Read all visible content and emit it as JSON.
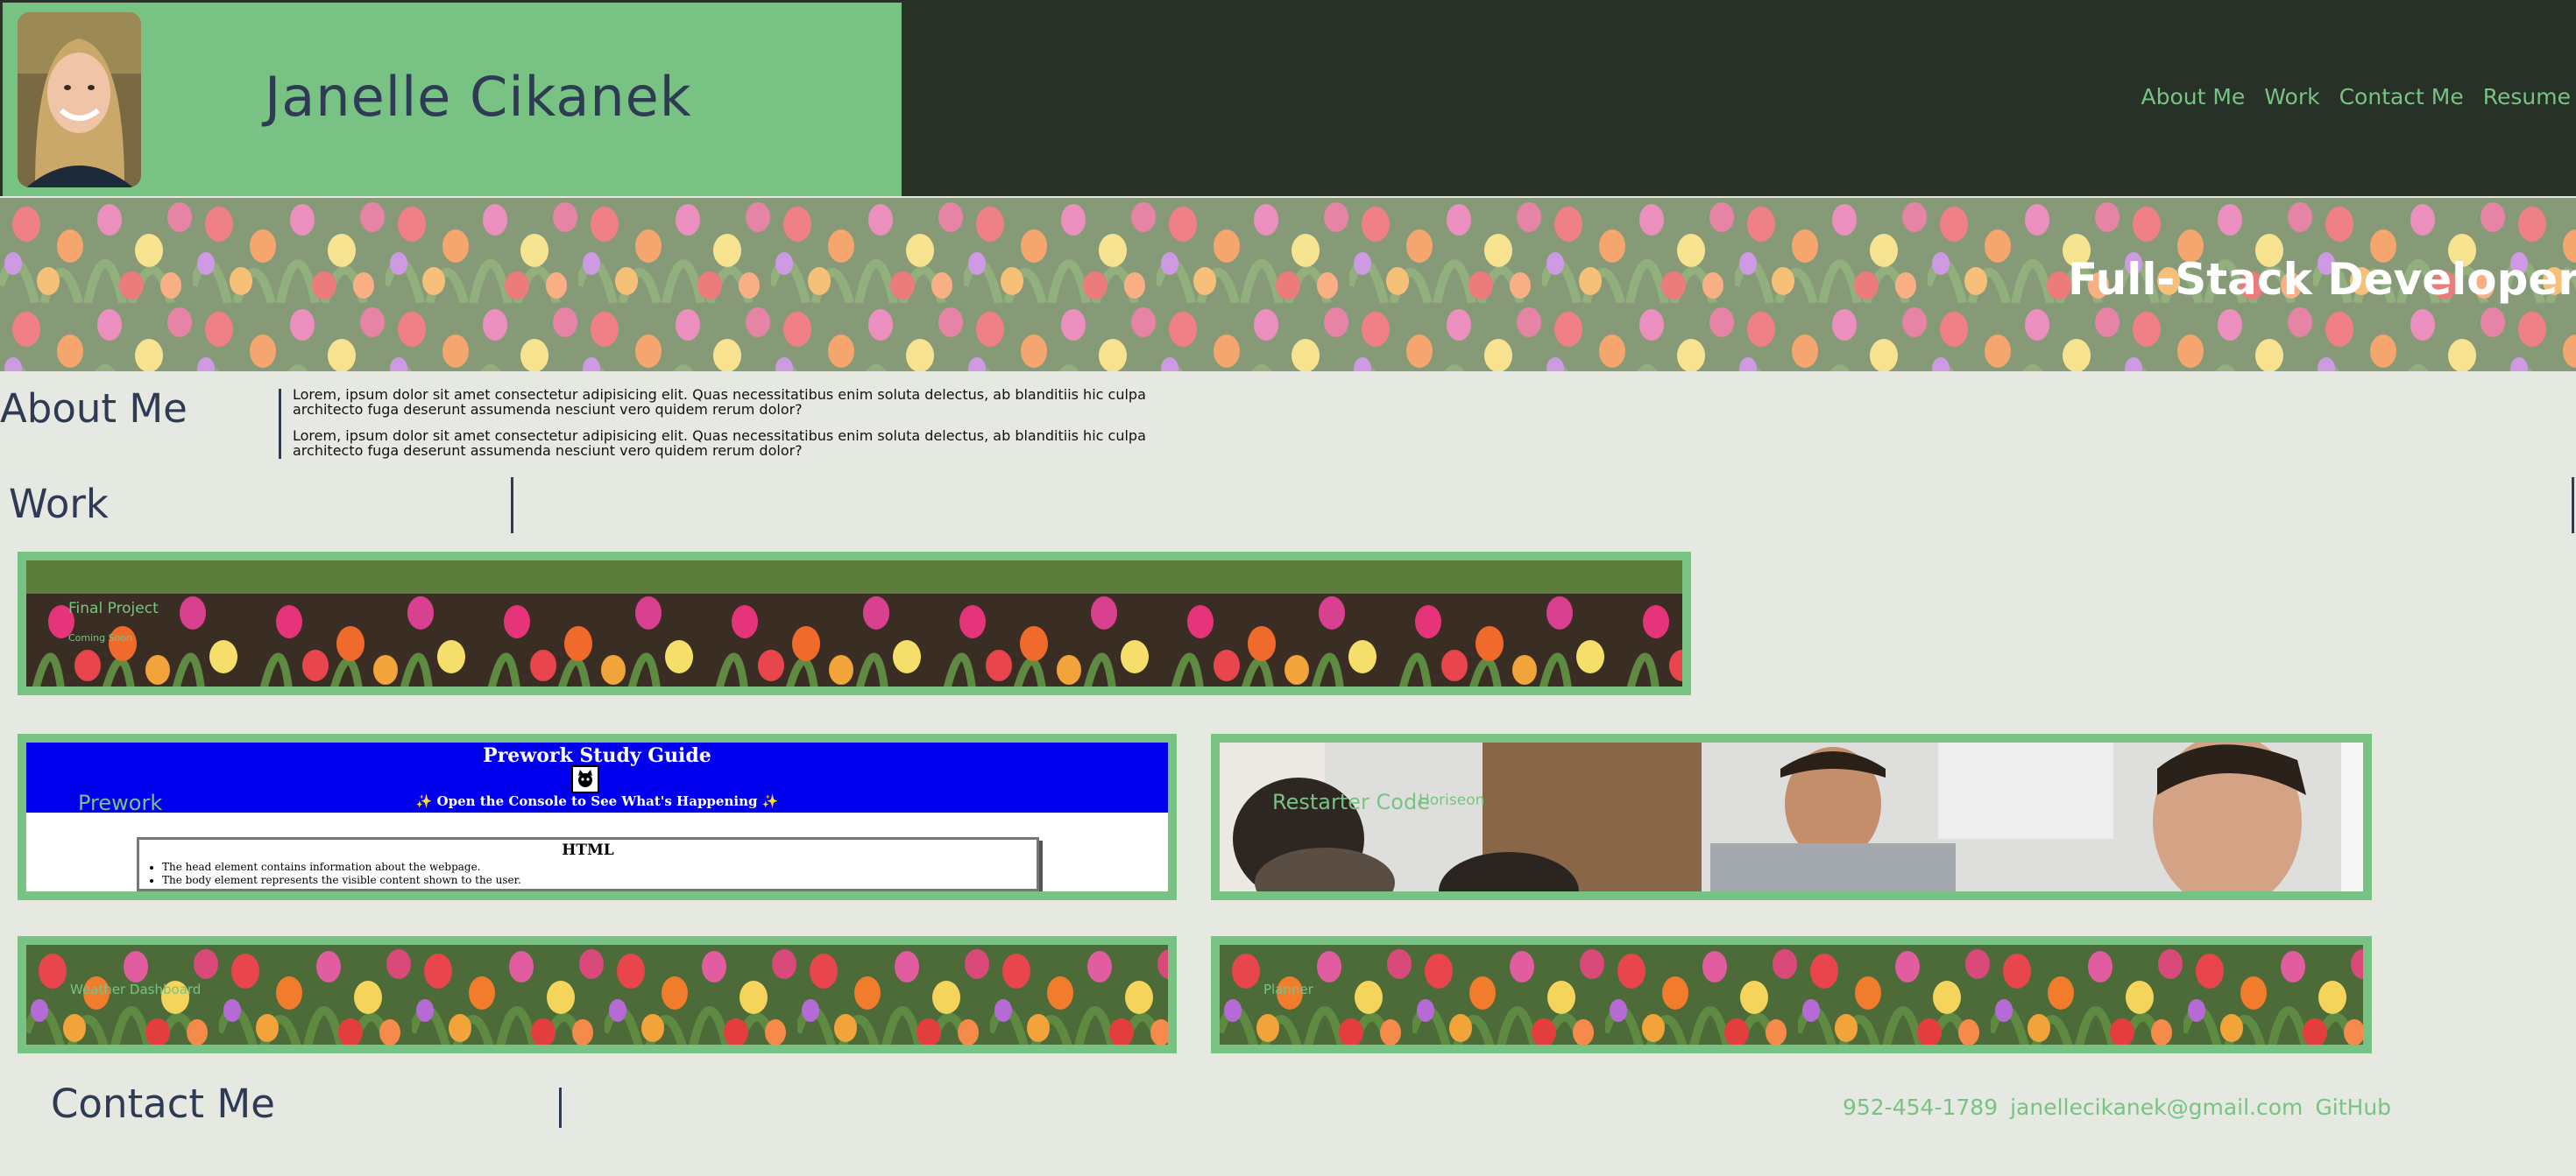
{
  "header": {
    "name": "Janelle Cikanek",
    "avatar_alt": "Janelle Cikanek portrait",
    "nav": [
      "About Me",
      "Work",
      "Contact Me",
      "Resume"
    ]
  },
  "hero": {
    "tagline": "Full-Stack Developer"
  },
  "about": {
    "title": "About Me",
    "paragraphs": [
      "Lorem, ipsum dolor sit amet consectetur adipisicing elit. Quas necessitatibus enim soluta delectus, ab blanditiis hic culpa architecto fuga deserunt assumenda nesciunt vero quidem rerum dolor?",
      "Lorem, ipsum dolor sit amet consectetur adipisicing elit. Quas necessitatibus enim soluta delectus, ab blanditiis hic culpa architecto fuga deserunt assumenda nesciunt vero quidem rerum dolor?"
    ]
  },
  "work": {
    "title": "Work",
    "projects": [
      {
        "title": "Final Project",
        "subtitle": "Coming Soon"
      },
      {
        "title": "Prework",
        "screenshot": {
          "heading": "Prework Study Guide",
          "subheading": "✨ Open the Console to See What's Happening ✨",
          "box_title": "HTML",
          "bullets": [
            "The head element contains information about the webpage.",
            "The body element represents the visible content shown to the user."
          ]
        }
      },
      {
        "title": "Restarter Code",
        "subtitle": "Horiseon"
      },
      {
        "title": "Weather Dashboard",
        "subtitle": ""
      },
      {
        "title": "Planner",
        "subtitle": ""
      }
    ]
  },
  "contact": {
    "title": "Contact Me",
    "phone": "952-454-1789",
    "email": "janellecikanek@gmail.com",
    "github": "GitHub"
  },
  "colors": {
    "header_dark": "#283128",
    "accent_green": "#78c383",
    "heading_navy": "#2f3a55",
    "page_bg": "#e6e9e1"
  }
}
